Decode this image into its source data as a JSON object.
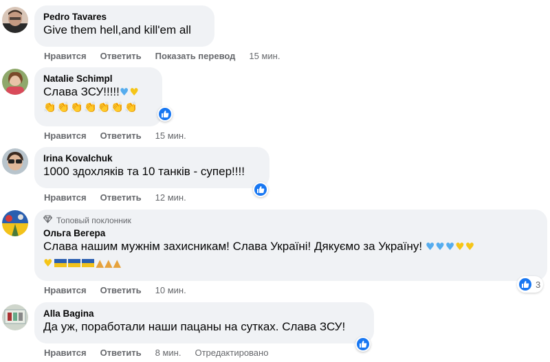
{
  "actions": {
    "like_label": "Нравится",
    "reply_label": "Ответить",
    "translate_label": "Показать перевод",
    "edited_label": "Отредактировано"
  },
  "comments": [
    {
      "author": "Pedro Tavares",
      "text": "Give them hell,and kill'em all",
      "time": "15 мин."
    },
    {
      "author": "Natalie Schimpl",
      "text": "Слава ЗСУ!!!!!",
      "emoji_line": "👏👏👏👏👏👏👏",
      "time": "15 мин."
    },
    {
      "author": "Irina Kovalchuk",
      "text": "1000 здохляків та 10 танків - супер!!!!",
      "time": "12 мин."
    },
    {
      "badge": "Топовый поклонник",
      "author": "Ольга Вегера",
      "text": "Слава нашим мужнім захисникам! Слава Україні! Дякуємо за Україну!",
      "time": "10 мин.",
      "reaction_count": "3"
    },
    {
      "author": "Alla Bagina",
      "text": "Да уж, поработали наши пацаны на сутках. Слава ЗСУ!",
      "time": "8 мин."
    }
  ],
  "colors": {
    "bubble": "#f0f2f5",
    "meta": "#65676b",
    "like_blue": "#1877f2"
  },
  "icons": [
    "thumbs-up-reaction-icon",
    "diamond-badge-icon",
    "blue-heart-emoji",
    "yellow-heart-emoji",
    "ukraine-flag-emoji",
    "praying-hands-emoji",
    "clapping-hands-emoji"
  ]
}
